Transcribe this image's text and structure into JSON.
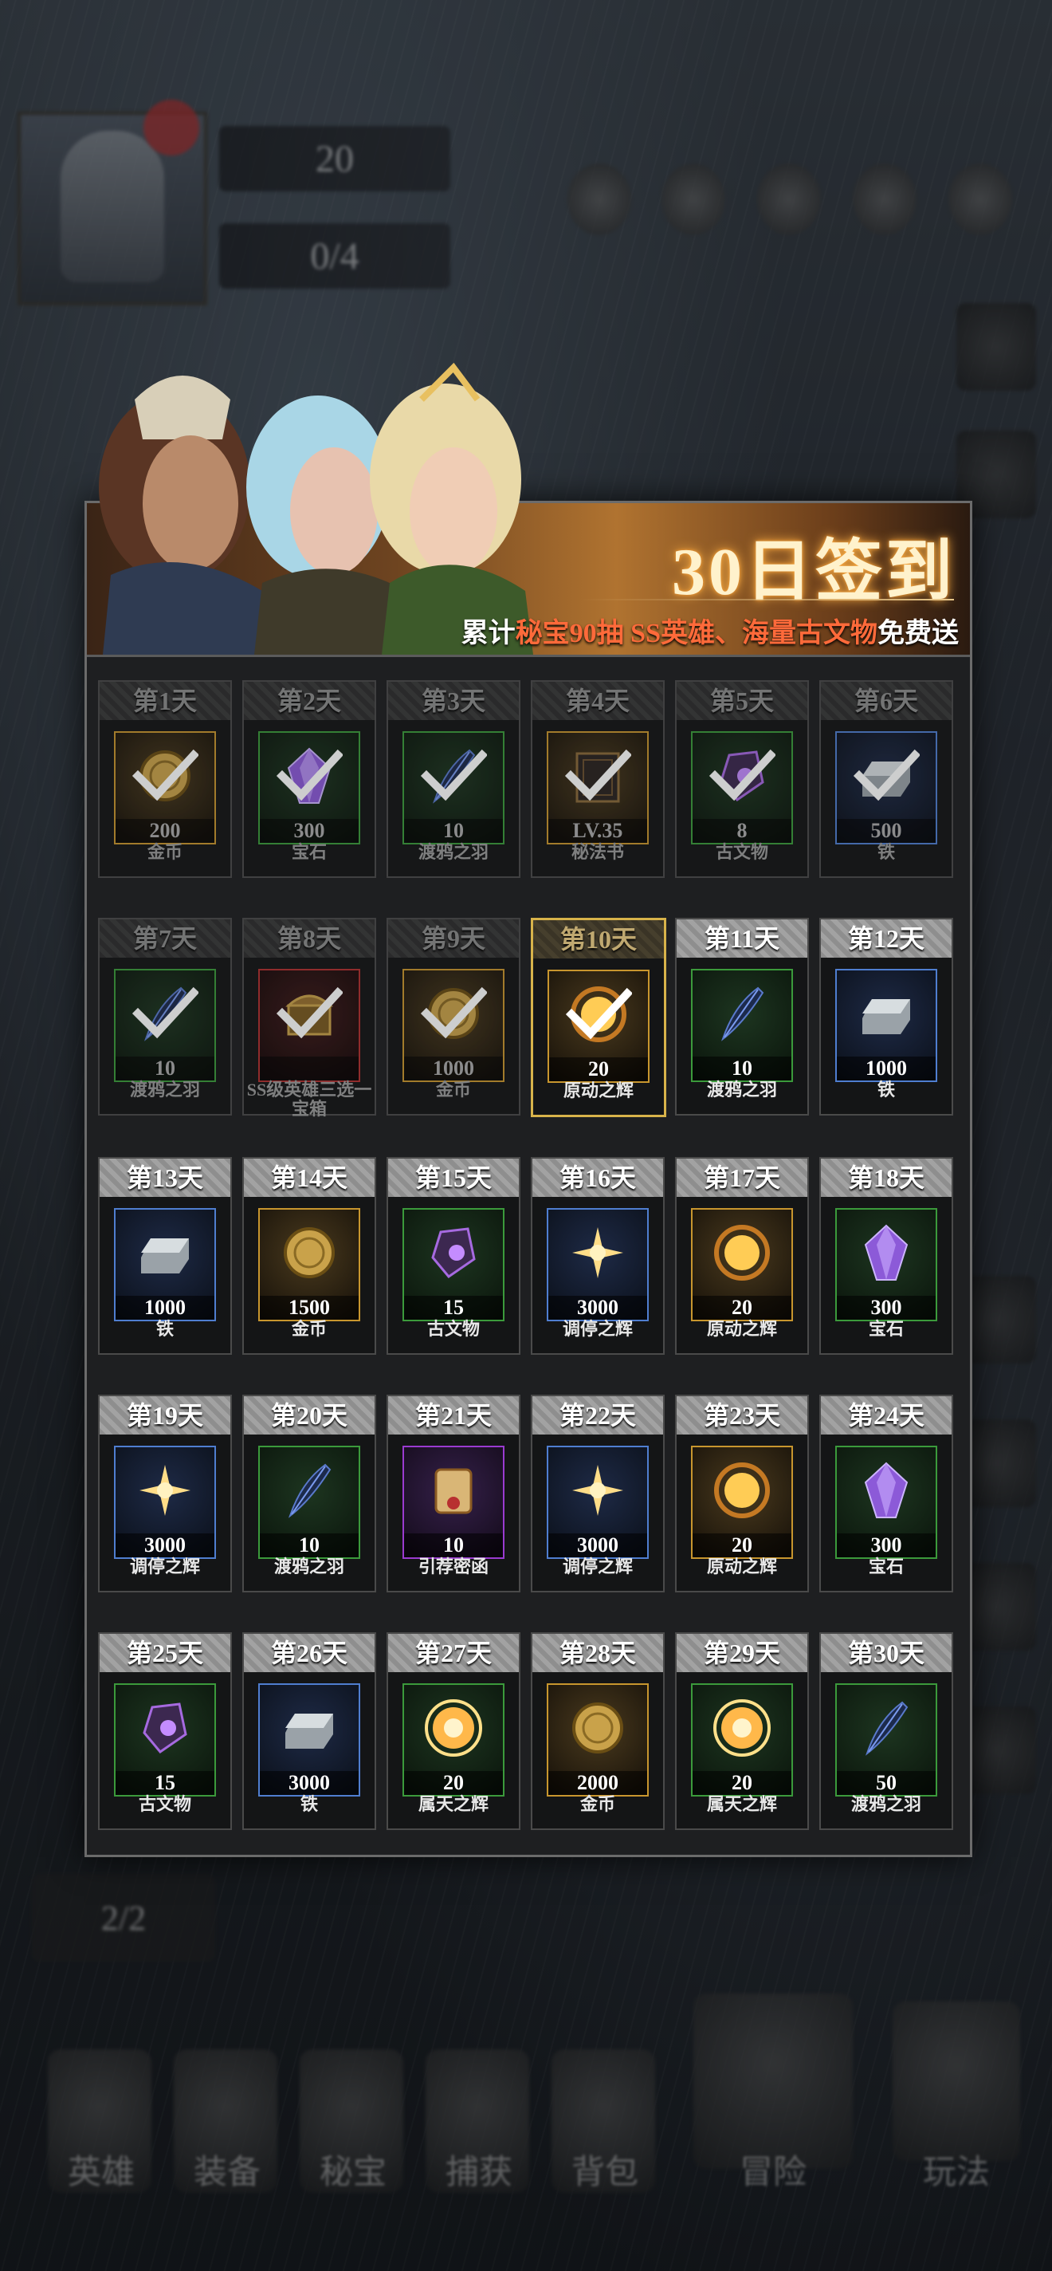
{
  "hud": {
    "level_value": "20",
    "stamina_value": "0/4",
    "bottom_nav": [
      {
        "label": "英雄"
      },
      {
        "label": "装备"
      },
      {
        "label": "秘宝"
      },
      {
        "label": "捕获"
      },
      {
        "label": "背包"
      },
      {
        "label": "冒险"
      },
      {
        "label": "玩法"
      }
    ],
    "task_count": "2/2"
  },
  "signin": {
    "title": "30日签到",
    "subtitle_prefix": "累计",
    "subtitle_highlight1": "秘宝90抽",
    "subtitle_highlight2": "SS英雄、海量古文物",
    "subtitle_suffix": "免费送",
    "days": [
      {
        "day": "第1天",
        "qty": "200",
        "name": "金币",
        "state": "claimed",
        "rarity": "gold",
        "icon": "gold-coin"
      },
      {
        "day": "第2天",
        "qty": "300",
        "name": "宝石",
        "state": "claimed",
        "rarity": "green",
        "icon": "purple-gem"
      },
      {
        "day": "第3天",
        "qty": "10",
        "name": "渡鸦之羽",
        "state": "claimed",
        "rarity": "green",
        "icon": "raven-feather"
      },
      {
        "day": "第4天",
        "qty": "LV.35",
        "name": "秘法书",
        "state": "claimed",
        "rarity": "gold",
        "icon": "spell-book"
      },
      {
        "day": "第5天",
        "qty": "8",
        "name": "古文物",
        "state": "claimed",
        "rarity": "green",
        "icon": "ancient-relic"
      },
      {
        "day": "第6天",
        "qty": "500",
        "name": "铁",
        "state": "claimed",
        "rarity": "blue",
        "icon": "iron-ingot"
      },
      {
        "day": "第7天",
        "qty": "10",
        "name": "渡鸦之羽",
        "state": "claimed",
        "rarity": "green",
        "icon": "raven-feather"
      },
      {
        "day": "第8天",
        "qty": "",
        "name": "SS级英雄三选一宝箱",
        "state": "claimed",
        "rarity": "red",
        "icon": "treasure-chest"
      },
      {
        "day": "第9天",
        "qty": "1000",
        "name": "金币",
        "state": "claimed",
        "rarity": "gold",
        "icon": "gold-coin"
      },
      {
        "day": "第10天",
        "qty": "20",
        "name": "原动之辉",
        "state": "current",
        "rarity": "gold",
        "icon": "prime-radiance"
      },
      {
        "day": "第11天",
        "qty": "10",
        "name": "渡鸦之羽",
        "state": "available",
        "rarity": "green",
        "icon": "raven-feather"
      },
      {
        "day": "第12天",
        "qty": "1000",
        "name": "铁",
        "state": "available",
        "rarity": "blue",
        "icon": "iron-ingot"
      },
      {
        "day": "第13天",
        "qty": "1000",
        "name": "铁",
        "state": "available",
        "rarity": "blue",
        "icon": "iron-ingot"
      },
      {
        "day": "第14天",
        "qty": "1500",
        "name": "金币",
        "state": "available",
        "rarity": "gold",
        "icon": "gold-coin"
      },
      {
        "day": "第15天",
        "qty": "15",
        "name": "古文物",
        "state": "available",
        "rarity": "green",
        "icon": "ancient-relic"
      },
      {
        "day": "第16天",
        "qty": "3000",
        "name": "调停之辉",
        "state": "available",
        "rarity": "blue",
        "icon": "mediation-radiance"
      },
      {
        "day": "第17天",
        "qty": "20",
        "name": "原动之辉",
        "state": "available",
        "rarity": "gold",
        "icon": "prime-radiance"
      },
      {
        "day": "第18天",
        "qty": "300",
        "name": "宝石",
        "state": "available",
        "rarity": "green",
        "icon": "purple-gem"
      },
      {
        "day": "第19天",
        "qty": "3000",
        "name": "调停之辉",
        "state": "available",
        "rarity": "blue",
        "icon": "mediation-radiance"
      },
      {
        "day": "第20天",
        "qty": "10",
        "name": "渡鸦之羽",
        "state": "available",
        "rarity": "green",
        "icon": "raven-feather"
      },
      {
        "day": "第21天",
        "qty": "10",
        "name": "引荐密函",
        "state": "available",
        "rarity": "purple",
        "icon": "scroll-letter"
      },
      {
        "day": "第22天",
        "qty": "3000",
        "name": "调停之辉",
        "state": "available",
        "rarity": "blue",
        "icon": "mediation-radiance"
      },
      {
        "day": "第23天",
        "qty": "20",
        "name": "原动之辉",
        "state": "available",
        "rarity": "gold",
        "icon": "prime-radiance"
      },
      {
        "day": "第24天",
        "qty": "300",
        "name": "宝石",
        "state": "available",
        "rarity": "green",
        "icon": "purple-gem"
      },
      {
        "day": "第25天",
        "qty": "15",
        "name": "古文物",
        "state": "available",
        "rarity": "green",
        "icon": "ancient-relic"
      },
      {
        "day": "第26天",
        "qty": "3000",
        "name": "铁",
        "state": "available",
        "rarity": "blue",
        "icon": "iron-ingot"
      },
      {
        "day": "第27天",
        "qty": "20",
        "name": "属天之辉",
        "state": "available",
        "rarity": "green",
        "icon": "celestial-radiance"
      },
      {
        "day": "第28天",
        "qty": "2000",
        "name": "金币",
        "state": "available",
        "rarity": "gold",
        "icon": "gold-coin"
      },
      {
        "day": "第29天",
        "qty": "20",
        "name": "属天之辉",
        "state": "available",
        "rarity": "green",
        "icon": "celestial-radiance"
      },
      {
        "day": "第30天",
        "qty": "50",
        "name": "渡鸦之羽",
        "state": "available",
        "rarity": "green",
        "icon": "raven-feather"
      }
    ]
  }
}
